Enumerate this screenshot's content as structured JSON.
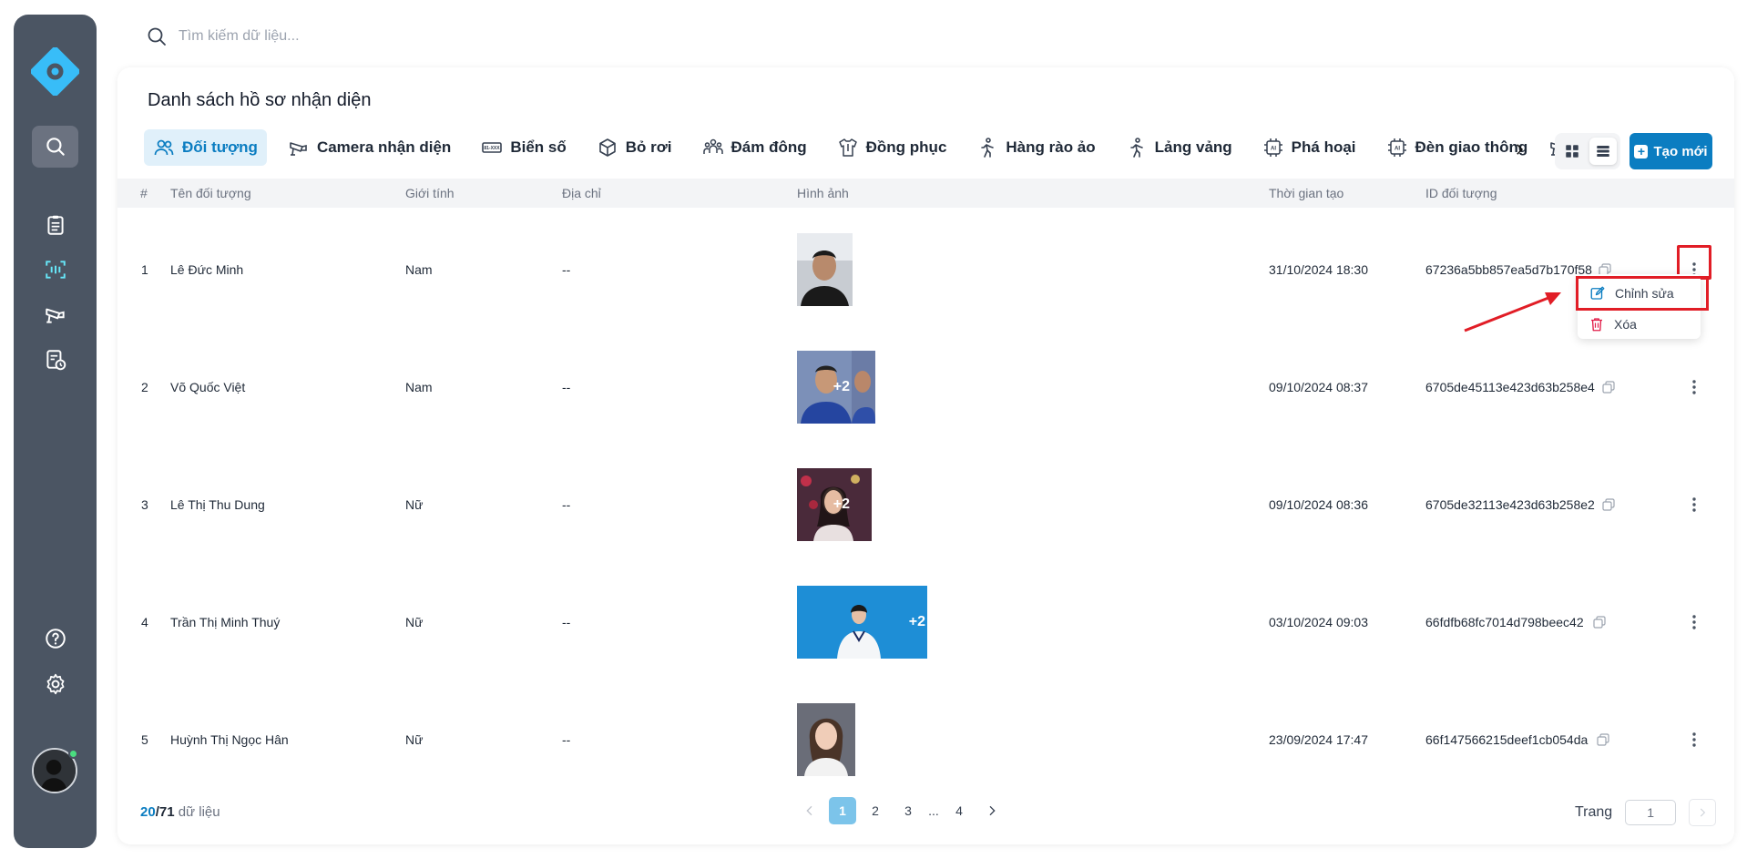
{
  "search": {
    "placeholder": "Tìm kiếm dữ liệu..."
  },
  "page": {
    "title": "Danh sách hồ sơ nhận diện"
  },
  "tabs": [
    {
      "label": "Đối tượng",
      "icon": "users-icon",
      "active": true
    },
    {
      "label": "Camera nhận diện",
      "icon": "camera-icon"
    },
    {
      "label": "Biển số",
      "icon": "license-plate-icon"
    },
    {
      "label": "Bỏ rơi",
      "icon": "box-icon"
    },
    {
      "label": "Đám đông",
      "icon": "crowd-icon"
    },
    {
      "label": "Đồng phục",
      "icon": "uniform-icon"
    },
    {
      "label": "Hàng rào ảo",
      "icon": "person-walk-icon"
    },
    {
      "label": "Lảng vảng",
      "icon": "person-walk-icon"
    },
    {
      "label": "Phá hoại",
      "icon": "ai-chip-icon"
    },
    {
      "label": "Đèn giao thông",
      "icon": "ai-chip-icon"
    }
  ],
  "create_button": {
    "label": "Tạo mới"
  },
  "table": {
    "headers": {
      "index": "#",
      "name": "Tên đối tượng",
      "gender": "Giới tính",
      "address": "Địa chỉ",
      "image": "Hình ảnh",
      "created": "Thời gian tạo",
      "id": "ID đối tượng"
    },
    "rows": [
      {
        "index": "1",
        "name": "Lê Đức Minh",
        "gender": "Nam",
        "address": "--",
        "extra": "",
        "created": "31/10/2024 18:30",
        "id": "67236a5bb857ea5d7b170f58"
      },
      {
        "index": "2",
        "name": "Võ Quốc Việt",
        "gender": "Nam",
        "address": "--",
        "extra": "+2",
        "created": "09/10/2024 08:37",
        "id": "6705de45113e423d63b258e4"
      },
      {
        "index": "3",
        "name": "Lê Thị Thu Dung",
        "gender": "Nữ",
        "address": "--",
        "extra": "+2",
        "created": "09/10/2024 08:36",
        "id": "6705de32113e423d63b258e2"
      },
      {
        "index": "4",
        "name": "Trần Thị Minh Thuý",
        "gender": "Nữ",
        "address": "--",
        "extra": "+2",
        "created": "03/10/2024 09:03",
        "id": "66fdfb68fc7014d798beec42"
      },
      {
        "index": "5",
        "name": "Huỳnh Thị Ngọc Hân",
        "gender": "Nữ",
        "address": "--",
        "extra": "",
        "created": "23/09/2024 17:47",
        "id": "66f147566215deef1cb054da"
      }
    ]
  },
  "row_menu": {
    "edit": "Chỉnh sửa",
    "delete": "Xóa"
  },
  "footer": {
    "shown": "20",
    "total": "/71",
    "unit": "dữ liệu",
    "pages": [
      "1",
      "2",
      "3",
      "...",
      "4"
    ],
    "current_page": "1",
    "goto_label": "Trang",
    "goto_value": "1"
  },
  "colors": {
    "accent": "#0b7dc1",
    "sidebar": "#4b5563",
    "annotation": "#e11d26"
  }
}
